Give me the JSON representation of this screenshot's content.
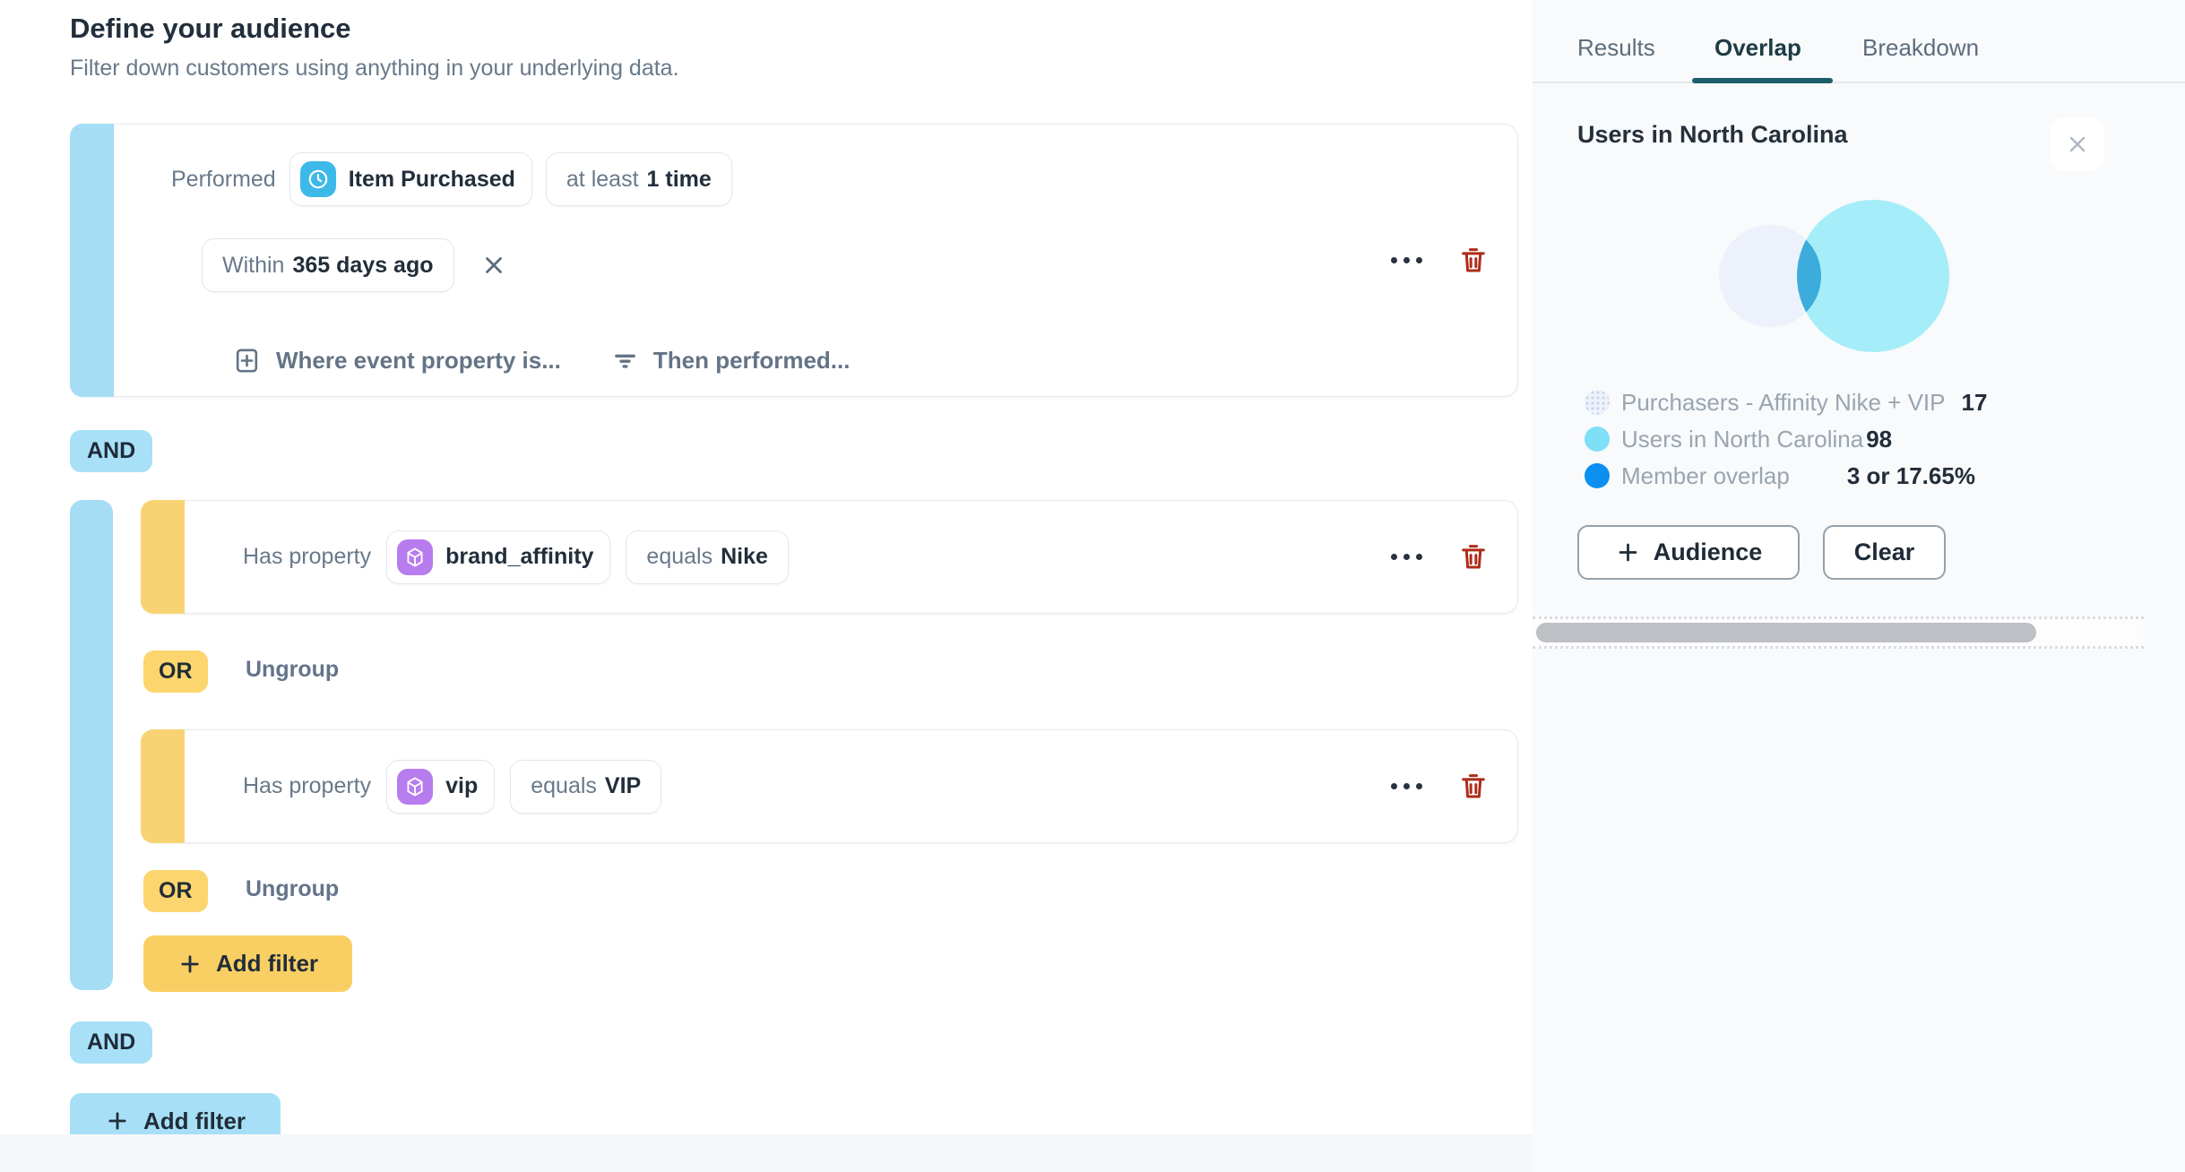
{
  "header": {
    "title": "Define your audience",
    "subtitle": "Filter down customers using anything in your underlying data."
  },
  "event_group": {
    "performed_label": "Performed",
    "event_name": "Item Purchased",
    "frequency_prefix": "at least",
    "frequency_value": "1 time",
    "window_prefix": "Within",
    "window_value": "365 days ago",
    "where_link": "Where event property is...",
    "then_link": "Then performed..."
  },
  "operators": {
    "and": "AND",
    "or": "OR",
    "ungroup_label": "Ungroup"
  },
  "property_group": {
    "rows": [
      {
        "label": "Has property",
        "property": "brand_affinity",
        "operator": "equals",
        "value": "Nike"
      },
      {
        "label": "Has property",
        "property": "vip",
        "operator": "equals",
        "value": "VIP"
      }
    ],
    "add_filter_label": "Add filter"
  },
  "root_add_filter_label": "Add filter",
  "panel": {
    "tabs": [
      "Results",
      "Overlap",
      "Breakdown"
    ],
    "active_tab": "Overlap",
    "title": "Users in North Carolina",
    "legend": [
      {
        "label": "Purchasers - Affinity Nike + VIP",
        "value": "17"
      },
      {
        "label": "Users in North Carolina",
        "value": "98"
      },
      {
        "label": "Member overlap",
        "value": "3 or 17.65%"
      }
    ],
    "buttons": {
      "audience": "Audience",
      "clear": "Clear"
    }
  },
  "chart_data": {
    "type": "venn",
    "sets": [
      {
        "label": "Purchasers - Affinity Nike + VIP",
        "size": 17,
        "color": "#ECF1FB"
      },
      {
        "label": "Users in North Carolina",
        "size": 98,
        "color": "#A5EDF9"
      }
    ],
    "overlap": {
      "label": "Member overlap",
      "size": 3,
      "percent": "17.65%",
      "color": "#3BACDB"
    },
    "legend_position": "bottom-left"
  },
  "icons": {
    "event_icon": "clock",
    "property_icon": "cube",
    "where_icon": "plus-square",
    "then_icon": "filter-lines",
    "remove_icon": "x",
    "more_icon": "ellipsis",
    "delete_icon": "trash",
    "close_icon": "x",
    "add_icon": "plus"
  },
  "colors": {
    "group_blue": "#A5DDF4",
    "group_yellow": "#F8D374",
    "and_badge": "#A7E0F7",
    "or_badge": "#FCD56E",
    "add_filter_yellow": "#F9CF63",
    "add_filter_blue": "#A6DFF6",
    "active_tab_underline": "#1E5E6A",
    "delete_red": "#AE2B1A",
    "event_icon_bg": "#3DB9E9",
    "property_icon_bg": "#B77CEE",
    "panel_bg": "#F8FAFB"
  }
}
